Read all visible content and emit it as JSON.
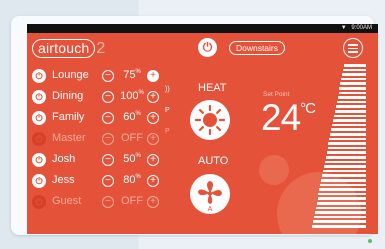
{
  "status_bar": {
    "time": "9:00AM"
  },
  "header": {
    "logo_text": "airtouch",
    "logo_suffix": "2",
    "zone_button": "Downstairs"
  },
  "zones": [
    {
      "name": "Lounge",
      "value": "75",
      "unit": "%",
      "on": true,
      "flag": "",
      "plus_filled": true
    },
    {
      "name": "Dining",
      "value": "100",
      "unit": "%",
      "on": true,
      "flag": "))",
      "plus_filled": false
    },
    {
      "name": "Family",
      "value": "60",
      "unit": "%",
      "on": true,
      "flag": "P",
      "plus_filled": false
    },
    {
      "name": "Master",
      "value": "OFF",
      "unit": "",
      "on": false,
      "flag": "P",
      "plus_filled": false
    },
    {
      "name": "Josh",
      "value": "50",
      "unit": "%",
      "on": true,
      "flag": "",
      "plus_filled": false
    },
    {
      "name": "Jess",
      "value": "80",
      "unit": "%",
      "on": true,
      "flag": "",
      "plus_filled": false
    },
    {
      "name": "Guest",
      "value": "OFF",
      "unit": "",
      "on": false,
      "flag": "",
      "plus_filled": false
    }
  ],
  "mode": {
    "label": "HEAT",
    "icon": "sun-icon"
  },
  "fan": {
    "label": "AUTO",
    "icon": "fan-icon",
    "badge": "A"
  },
  "setpoint": {
    "label": "Set Point",
    "value": "24",
    "unit": "°C"
  },
  "colors": {
    "accent": "#e4523a",
    "white": "#ffffff"
  }
}
